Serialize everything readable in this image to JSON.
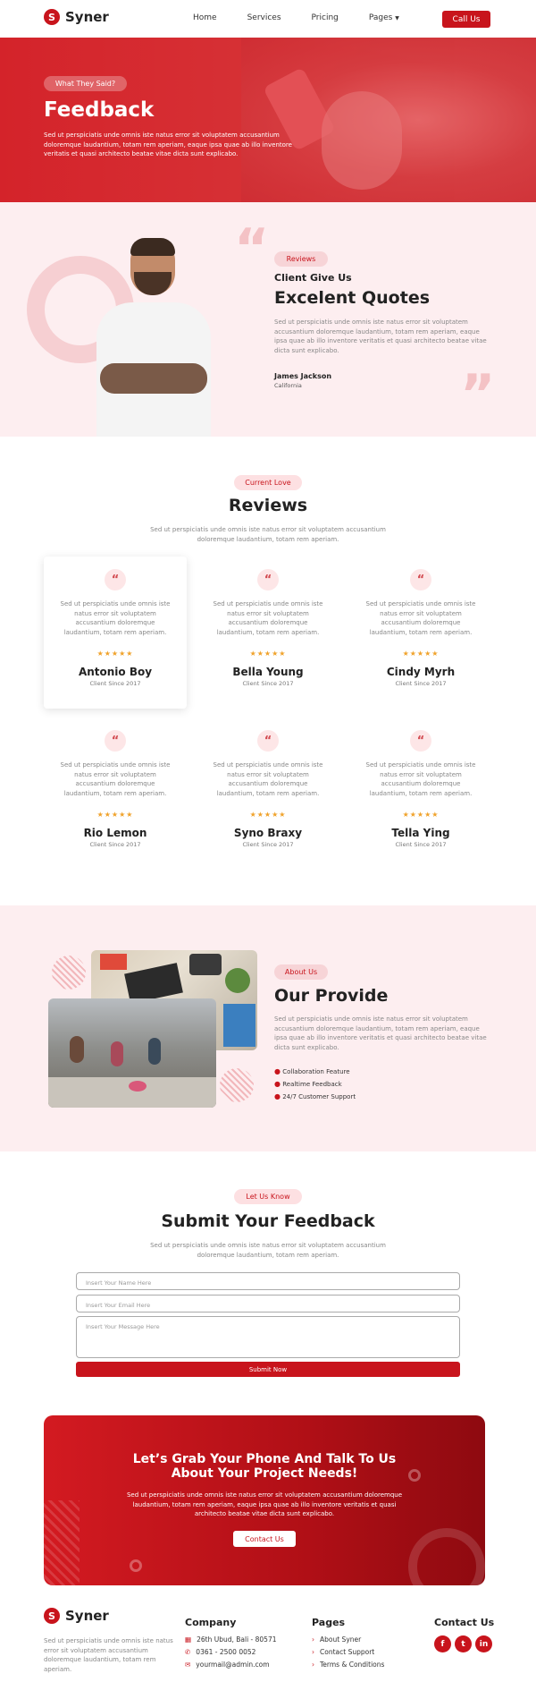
{
  "brand": {
    "mark": "S",
    "name": "Syner"
  },
  "nav": {
    "items": [
      "Home",
      "Services",
      "Pricing",
      "Pages"
    ],
    "cta": "Call Us"
  },
  "hero": {
    "pill": "What They Said?",
    "title": "Feedback",
    "text": "Sed ut perspiciatis unde omnis iste natus error sit voluptatem accusantium doloremque laudantium, totam rem aperiam, eaque ipsa quae ab illo inventore veritatis et quasi architecto beatae vitae dicta sunt explicabo."
  },
  "quote": {
    "pill": "Reviews",
    "subtitle": "Client Give Us",
    "title": "Excelent Quotes",
    "text": "Sed ut perspiciatis unde omnis iste natus error sit voluptatem accusantium doloremque laudantium, totam rem aperiam, eaque ipsa quae ab illo inventore veritatis et quasi architecto beatae vitae dicta sunt explicabo.",
    "author": "James Jackson",
    "location": "California"
  },
  "reviews": {
    "pill": "Current Love",
    "title": "Reviews",
    "text": "Sed ut perspiciatis unde omnis iste natus error sit voluptatem accusantium doloremque laudantium, totam rem aperiam.",
    "card_text": "Sed ut perspiciatis unde omnis iste natus error sit voluptatem accusantium doloremque laudantium, totam rem aperiam.",
    "stars": "★★★★★",
    "items": [
      {
        "name": "Antonio Boy",
        "since": "Client Since 2017",
        "rating": 5
      },
      {
        "name": "Bella Young",
        "since": "Client Since 2017",
        "rating": 5
      },
      {
        "name": "Cindy Myrh",
        "since": "Client Since 2017",
        "rating": 5
      },
      {
        "name": "Rio Lemon",
        "since": "Client Since 2017",
        "rating": 5
      },
      {
        "name": "Syno Braxy",
        "since": "Client Since 2017",
        "rating": 5
      },
      {
        "name": "Tella Ying",
        "since": "Client Since 2017",
        "rating": 5
      }
    ]
  },
  "provide": {
    "pill": "About Us",
    "title": "Our Provide",
    "text": "Sed ut perspiciatis unde omnis iste natus error sit voluptatem accusantium doloremque laudantium, totam rem aperiam, eaque ipsa quae ab illo inventore veritatis et quasi architecto beatae vitae dicta sunt explicabo.",
    "features": [
      "Collaboration Feature",
      "Realtime Feedback",
      "24/7 Customer Support"
    ]
  },
  "form": {
    "pill": "Let Us Know",
    "title": "Submit Your Feedback",
    "text": "Sed ut perspiciatis unde omnis iste natus error sit voluptatem accusantium doloremque laudantium, totam rem aperiam.",
    "name_placeholder": "Insert Your Name Here",
    "email_placeholder": "Insert Your Email Here",
    "message_placeholder": "Insert Your Message Here",
    "submit": "Submit Now"
  },
  "cta": {
    "title_line1": "Let’s Grab Your Phone And Talk To Us",
    "title_line2": "About Your Project Needs!",
    "text": "Sed ut perspiciatis unde omnis iste natus error sit voluptatem accusantium doloremque laudantium, totam rem aperiam, eaque ipsa quae ab illo inventore veritatis et quasi architecto beatae vitae dicta sunt explicabo.",
    "button": "Contact Us"
  },
  "footer": {
    "about": "Sed ut perspiciatis unde omnis iste natus error sit voluptatem accusantium doloremque laudantium, totam rem aperiam.",
    "company_title": "Company",
    "address": "26th Ubud, Bali - 80571",
    "phone": "0361 - 2500 0052",
    "email": "yourmail@admin.com",
    "pages_title": "Pages",
    "pages": [
      "About Syner",
      "Contact Support",
      "Terms & Conditions"
    ],
    "contact_title": "Contact Us",
    "socials": [
      "facebook-icon",
      "twitter-icon",
      "linkedin-icon"
    ]
  },
  "colors": {
    "accent": "#c8141c",
    "pink_bg": "#fdeef0"
  }
}
